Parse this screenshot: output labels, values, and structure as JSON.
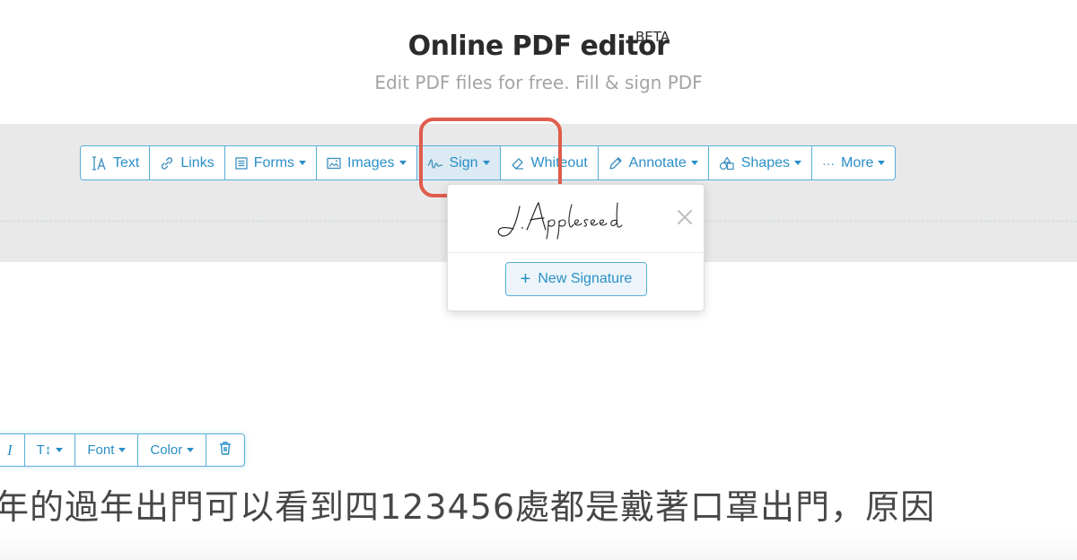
{
  "header": {
    "title": "Online PDF editor",
    "badge": "BETA",
    "subtitle": "Edit PDF files for free. Fill & sign PDF"
  },
  "toolbar": {
    "items": [
      {
        "label": "Text",
        "icon": "text-cursor-icon",
        "caret": false
      },
      {
        "label": "Links",
        "icon": "link-icon",
        "caret": false
      },
      {
        "label": "Forms",
        "icon": "form-icon",
        "caret": true
      },
      {
        "label": "Images",
        "icon": "image-icon",
        "caret": true
      },
      {
        "label": "Sign",
        "icon": "signature-icon",
        "caret": true,
        "active": true
      },
      {
        "label": "Whiteout",
        "icon": "eraser-icon",
        "caret": false
      },
      {
        "label": "Annotate",
        "icon": "pencil-icon",
        "caret": true
      },
      {
        "label": "Shapes",
        "icon": "shapes-icon",
        "caret": true
      },
      {
        "label": "More",
        "icon": "ellipsis-icon",
        "caret": true
      }
    ]
  },
  "sign_dropdown": {
    "signature_text": "J.Appleseed",
    "new_signature_label": "New Signature"
  },
  "format_toolbar": {
    "italic_label": "I",
    "size_label": "T↕",
    "font_label": "Font",
    "color_label": "Color"
  },
  "document": {
    "text": "年的過年出門可以看到四123456處都是戴著口罩出門，原因"
  },
  "colors": {
    "accent": "#2a8fc7",
    "highlight": "#e05c4c",
    "band": "#e9e9e9"
  }
}
